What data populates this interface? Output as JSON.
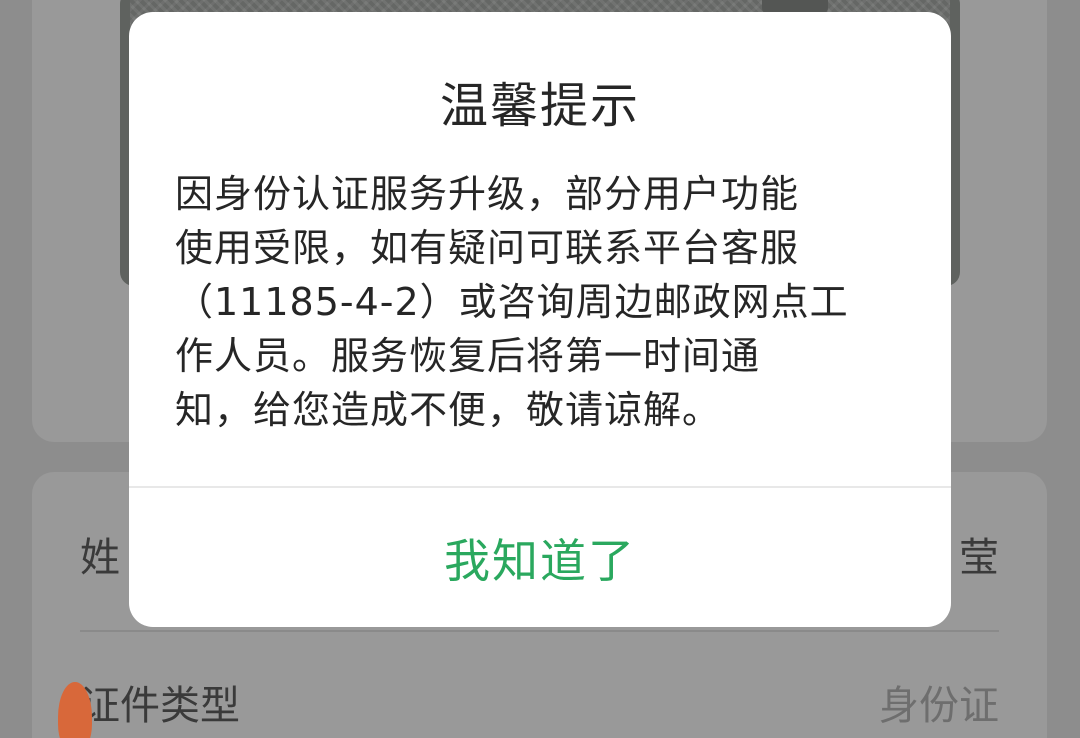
{
  "dialog": {
    "title": "温馨提示",
    "message": "因身份认证服务升级，部分用户功能\n使用受限，如有疑问可联系平台客服\n（11185-4-2）或咨询周边邮政网点工\n作人员。服务恢复后将第一时间通\n知，给您造成不便，敬请谅解。",
    "confirm_label": "我知道了",
    "confirm_color": "#2aa85e"
  },
  "form": {
    "name_label": "姓",
    "name_value": "莹",
    "id_type_label": "证件类型",
    "id_type_value": "身份证"
  }
}
